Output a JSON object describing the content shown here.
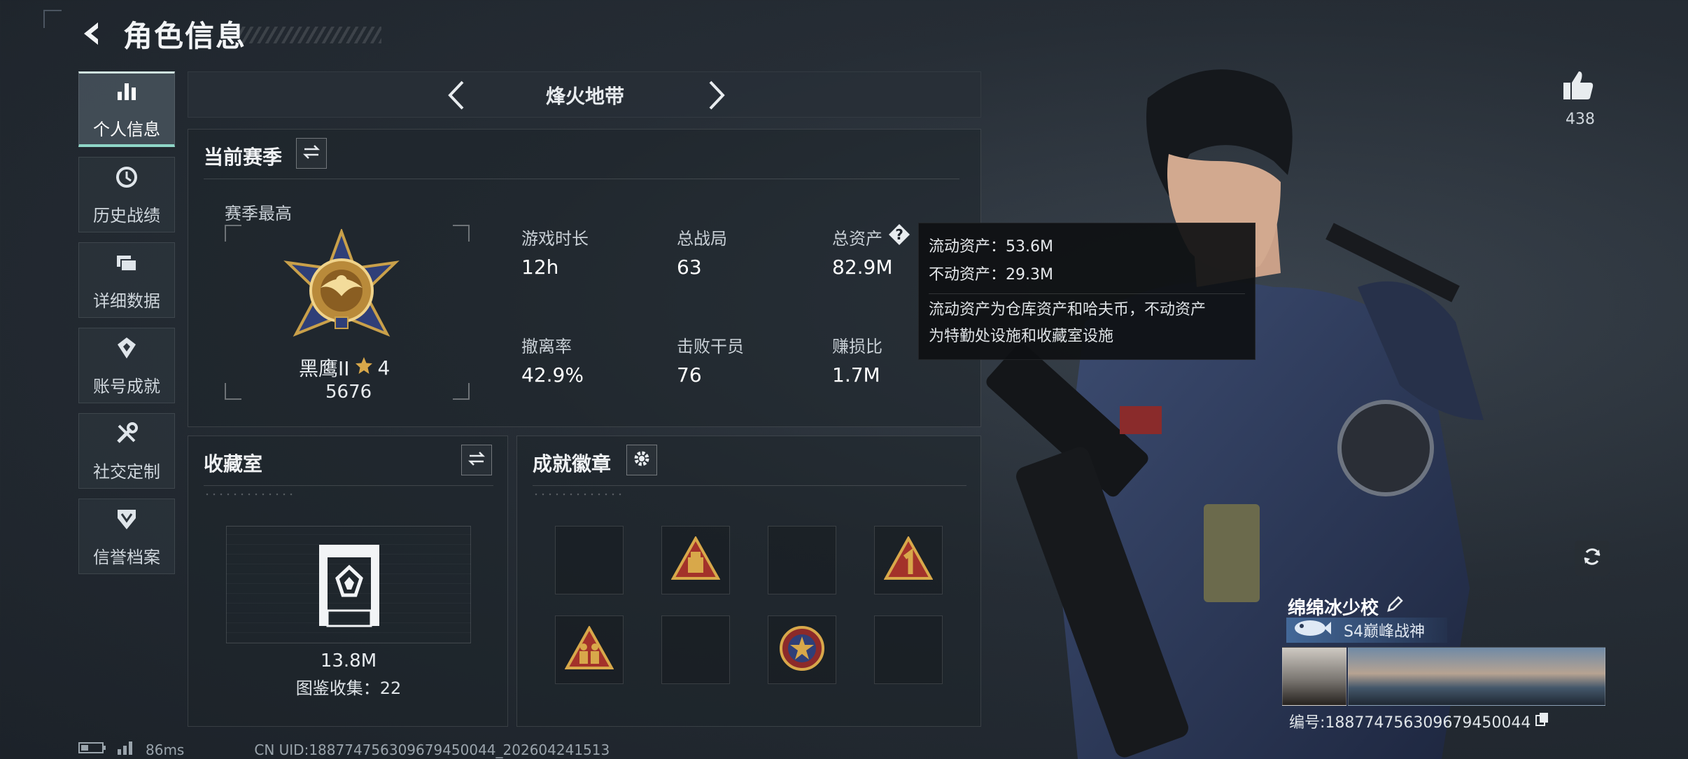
{
  "header": {
    "title": "角色信息"
  },
  "sidebar": {
    "items": [
      {
        "label": "个人信息",
        "icon": "bar-chart-icon",
        "active": true
      },
      {
        "label": "历史战绩",
        "icon": "history-clock-icon"
      },
      {
        "label": "详细数据",
        "icon": "folder-icon"
      },
      {
        "label": "账号成就",
        "icon": "achievement-icon"
      },
      {
        "label": "社交定制",
        "icon": "tools-icon"
      },
      {
        "label": "信誉档案",
        "icon": "shield-icon"
      }
    ]
  },
  "season_bar": {
    "name": "烽火地带"
  },
  "current_season": {
    "title": "当前赛季",
    "best_label": "赛季最高",
    "rank_name": "黑鹰II",
    "rank_stars": "4",
    "rank_score": "5676",
    "stats": [
      {
        "label": "游戏时长",
        "value": "12h"
      },
      {
        "label": "总战局",
        "value": "63"
      },
      {
        "label": "总资产",
        "value": "82.9M"
      },
      {
        "label": "撤离率",
        "value": "42.9%"
      },
      {
        "label": "击败干员",
        "value": "76"
      },
      {
        "label": "赚损比",
        "value": "1.7M"
      }
    ]
  },
  "tooltip": {
    "line1": "流动资产：53.6M",
    "line2": "不动资产：29.3M",
    "desc1": "流动资产为仓库资产和哈夫币，不动资产",
    "desc2": "为特勤处设施和收藏室设施"
  },
  "collection": {
    "title": "收藏室",
    "value": "13.8M",
    "catalog": "图鉴收集：22"
  },
  "badges": {
    "title": "成就徽章",
    "slots": [
      "empty",
      "triangle-badge-warehouse",
      "empty",
      "triangle-badge-number-one",
      "triangle-badge-soldiers",
      "empty",
      "round-badge-star",
      "empty"
    ]
  },
  "profile": {
    "likes": "438",
    "nickname": "绵绵冰少校",
    "title_badge": "S4巅峰战神",
    "player_id": "编号:1887747563096794500​44"
  },
  "footer": {
    "ping": "86ms",
    "uid": "CN UID:18877475630967945​0044_202604241513"
  },
  "colors": {
    "accent": "#8fd6c7",
    "gold": "#d8a84a",
    "panel": "#1e242a"
  }
}
